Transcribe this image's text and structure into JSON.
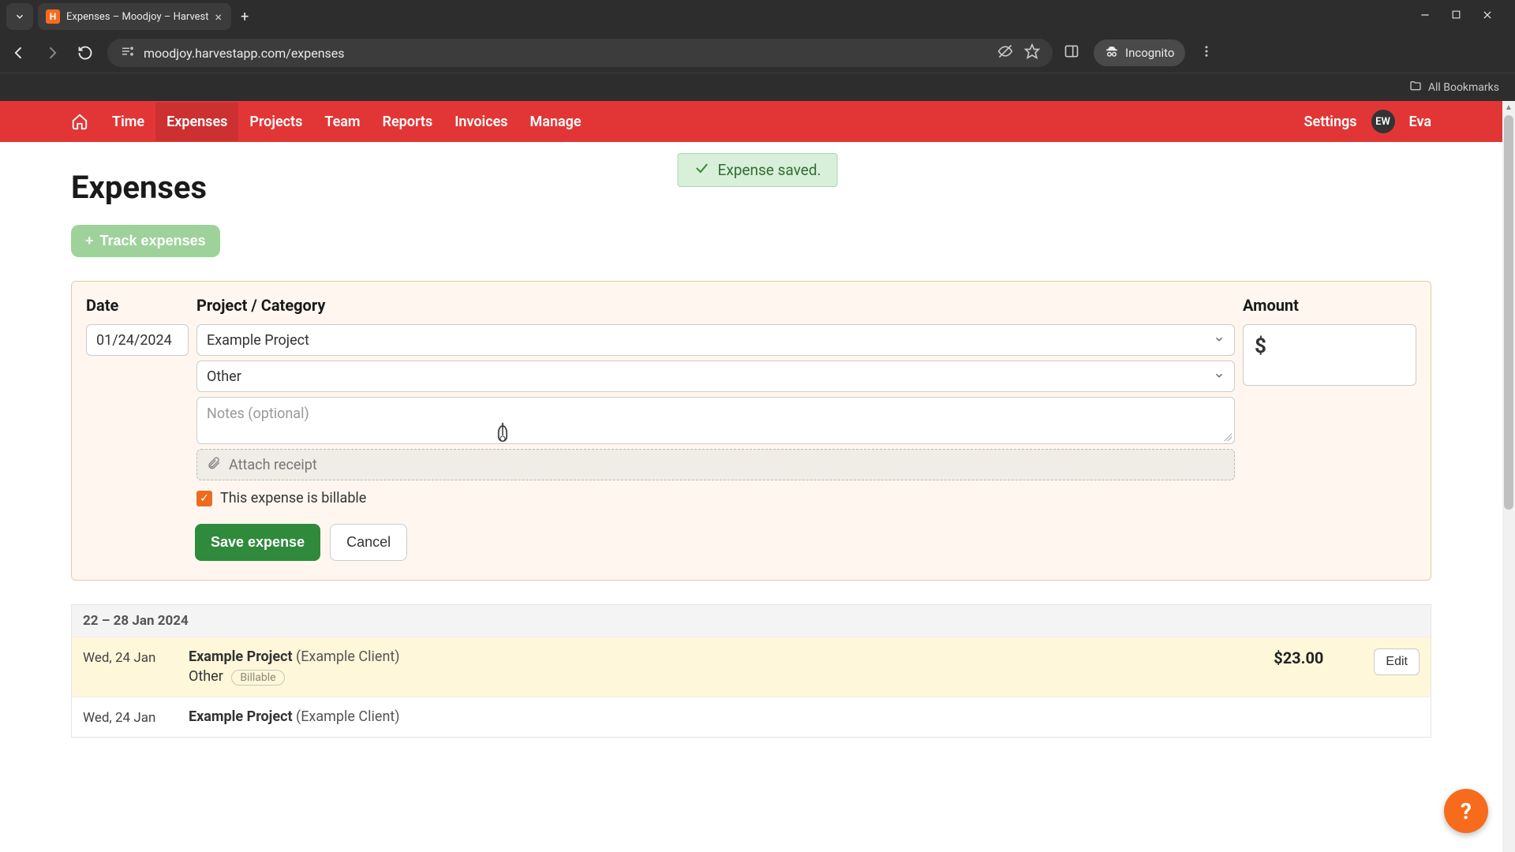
{
  "browser": {
    "tab_title": "Expenses – Moodjoy – Harvest",
    "url": "moodjoy.harvestapp.com/expenses",
    "incognito_label": "Incognito",
    "all_bookmarks": "All Bookmarks"
  },
  "nav": {
    "items": [
      "Time",
      "Expenses",
      "Projects",
      "Team",
      "Reports",
      "Invoices",
      "Manage"
    ],
    "active_index": 1,
    "settings": "Settings",
    "user_initials": "EW",
    "user_name": "Eva"
  },
  "flash": {
    "message": "Expense saved."
  },
  "page": {
    "title": "Expenses",
    "track_btn": "Track expenses"
  },
  "form": {
    "labels": {
      "date": "Date",
      "project_category": "Project / Category",
      "amount": "Amount"
    },
    "date_value": "01/24/2024",
    "project_value": "Example Project",
    "category_value": "Other",
    "notes_placeholder": "Notes (optional)",
    "attach_label": "Attach receipt",
    "currency_symbol": "$",
    "billable_label": "This expense is billable",
    "save_label": "Save expense",
    "cancel_label": "Cancel"
  },
  "list": {
    "group_header": "22 – 28 Jan 2024",
    "rows": [
      {
        "date": "Wed, 24 Jan",
        "project": "Example Project",
        "client": "(Example Client)",
        "category": "Other",
        "badge": "Billable",
        "amount": "$23.00",
        "edit": "Edit",
        "highlight": true
      },
      {
        "date": "Wed, 24 Jan",
        "project": "Example Project",
        "client": "(Example Client)",
        "category": "",
        "badge": "",
        "amount": "",
        "edit": "",
        "highlight": false
      }
    ]
  },
  "fab": {
    "label": "?"
  }
}
